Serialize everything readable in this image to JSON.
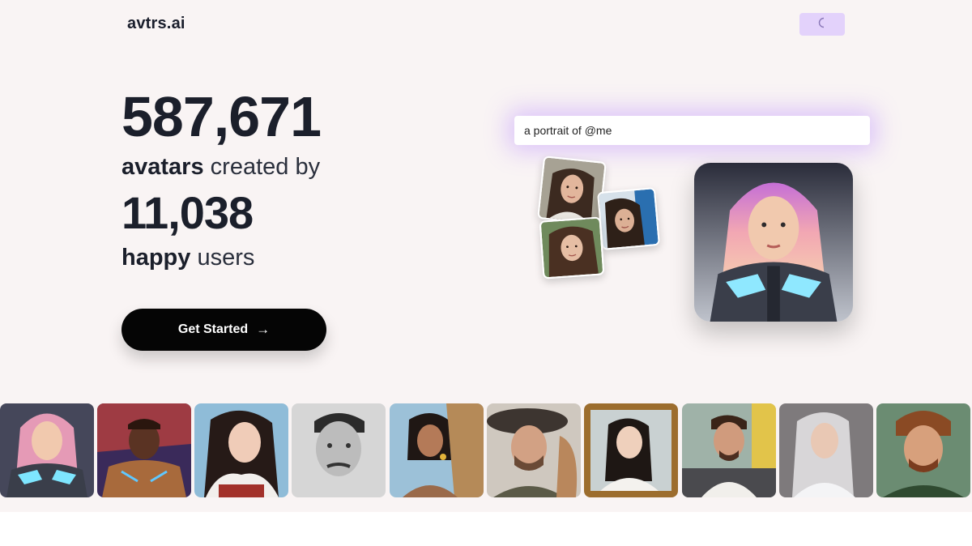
{
  "header": {
    "logo": "avtrs.ai",
    "theme_toggle_icon": "moon-icon",
    "theme_toggle_color": "#e3d2fb"
  },
  "hero": {
    "avatar_count": "587,671",
    "avatars_word": "avatars",
    "created_by": "created by",
    "user_count": "11,038",
    "happy_word": "happy",
    "users_word": "users",
    "cta_label": "Get Started",
    "cta_arrow": "→"
  },
  "demo": {
    "prompt_text": "a portrait of @me",
    "input_photos": [
      "woman-portrait-1",
      "woman-portrait-2",
      "woman-portrait-3"
    ],
    "result": "cyberpunk-woman-avatar"
  },
  "gallery": [
    "cyberpunk-woman-avatar",
    "electric-man-avatar",
    "fantasy-woman-avatar",
    "pencil-sketch-man-avatar",
    "portrait-woman-avatar",
    "rugged-man-avatar",
    "framed-painting-woman-avatar",
    "city-man-avatar",
    "silver-hair-woman-avatar",
    "game-character-man-avatar"
  ],
  "colors": {
    "background": "#f9f4f4",
    "cta": "#050505",
    "glow": "#ba8cff"
  }
}
